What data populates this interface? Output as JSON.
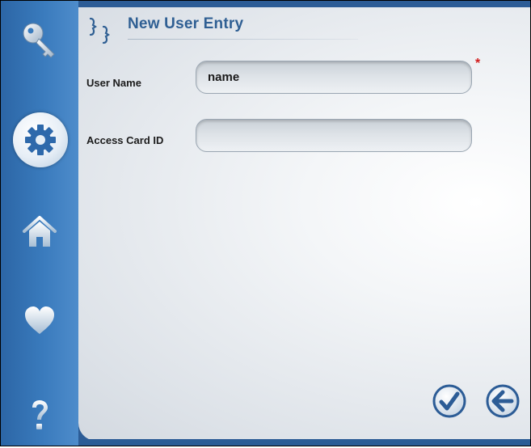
{
  "window": {
    "title": "New User Entry"
  },
  "sidebar": {
    "items": [
      {
        "icon": "key-icon",
        "active": false
      },
      {
        "icon": "gear-icon",
        "active": true
      },
      {
        "icon": "home-icon",
        "active": false
      },
      {
        "icon": "heart-icon",
        "active": false
      },
      {
        "icon": "question-icon",
        "active": false
      }
    ]
  },
  "form": {
    "user_name": {
      "label": "User Name",
      "placeholder": "name",
      "value": "",
      "required_mark": "*"
    },
    "access_card": {
      "label": "Access Card ID",
      "placeholder": "",
      "value": ""
    }
  },
  "actions": {
    "confirm_icon": "checkmark-icon",
    "back_icon": "arrow-left-icon"
  },
  "colors": {
    "sidebar_blue": "#3a7bbd",
    "title_blue": "#2f5f93",
    "required_red": "#d21c1c"
  }
}
